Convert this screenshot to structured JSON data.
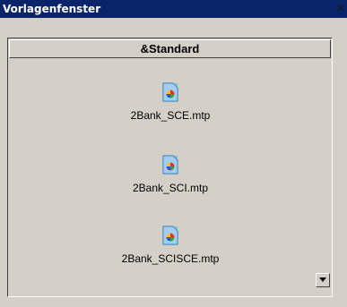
{
  "window": {
    "title": "Vorlagenfenster",
    "close_symbol": "✕"
  },
  "tab": {
    "label": "&Standard"
  },
  "files": [
    {
      "name": "2Bank_SCE.mtp",
      "icon": "template-file-icon"
    },
    {
      "name": "2Bank_SCI.mtp",
      "icon": "template-file-icon"
    },
    {
      "name": "2Bank_SCISCE.mtp",
      "icon": "template-file-icon"
    }
  ],
  "scroll": {
    "icon": "scroll-down-arrow-icon"
  },
  "colors": {
    "titlebar": "#0a246a",
    "face": "#d4d0c8"
  }
}
